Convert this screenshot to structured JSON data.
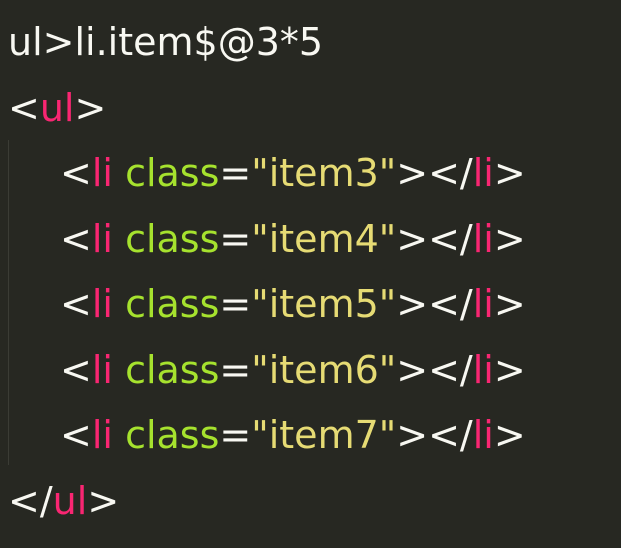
{
  "abbreviation": "ul>li.item$@3*5",
  "outer": {
    "open_bracket": "<",
    "close_bracket": ">",
    "close_open": "</",
    "tag": "ul"
  },
  "items": [
    {
      "lt": "<",
      "tag": "li",
      "attr": "class",
      "eq": "=",
      "value": "\"item3\"",
      "mid": "></",
      "tag2": "li",
      "gt": ">"
    },
    {
      "lt": "<",
      "tag": "li",
      "attr": "class",
      "eq": "=",
      "value": "\"item4\"",
      "mid": "></",
      "tag2": "li",
      "gt": ">"
    },
    {
      "lt": "<",
      "tag": "li",
      "attr": "class",
      "eq": "=",
      "value": "\"item5\"",
      "mid": "></",
      "tag2": "li",
      "gt": ">"
    },
    {
      "lt": "<",
      "tag": "li",
      "attr": "class",
      "eq": "=",
      "value": "\"item6\"",
      "mid": "></",
      "tag2": "li",
      "gt": ">"
    },
    {
      "lt": "<",
      "tag": "li",
      "attr": "class",
      "eq": "=",
      "value": "\"item7\"",
      "mid": "></",
      "tag2": "li",
      "gt": ">"
    }
  ],
  "colors": {
    "background": "#272822",
    "text": "#f8f8f2",
    "tag": "#f92672",
    "attribute": "#a6e22e",
    "string": "#e6db74"
  }
}
